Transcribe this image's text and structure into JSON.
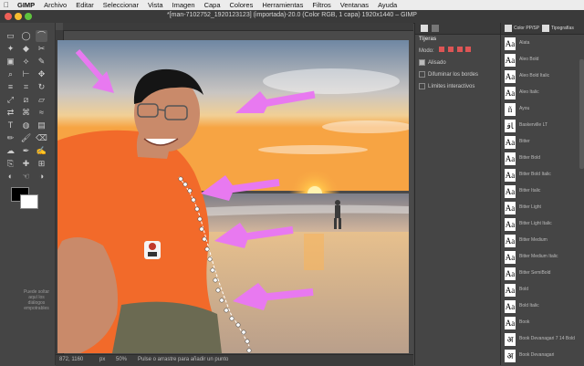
{
  "menubar": {
    "app": "GIMP",
    "items": [
      "Archivo",
      "Editar",
      "Seleccionar",
      "Vista",
      "Imagen",
      "Capa",
      "Colores",
      "Herramientas",
      "Filtros",
      "Ventanas",
      "Ayuda"
    ]
  },
  "window": {
    "title": "*[man-7102752_1920123123] (importada)-20.0 (Color RGB, 1 capa) 1920x1440 – GIMP"
  },
  "toolbox": {
    "hint": "Puede soltar aquí los diálogos empotrables",
    "icons": [
      "rect-select-icon",
      "ellipse-select-icon",
      "free-select-icon",
      "fuzzy-select-icon",
      "color-select-icon",
      "scissors-select-icon",
      "foreground-select-icon",
      "paths-icon",
      "color-picker-icon",
      "zoom-icon",
      "measure-icon",
      "move-icon",
      "align-icon",
      "crop-icon",
      "rotate-icon",
      "scale-icon",
      "shear-icon",
      "perspective-icon",
      "flip-icon",
      "cage-icon",
      "warp-icon",
      "text-icon",
      "bucket-fill-icon",
      "gradient-icon",
      "pencil-icon",
      "paintbrush-icon",
      "eraser-icon",
      "airbrush-icon",
      "ink-icon",
      "mypaint-icon",
      "clone-icon",
      "heal-icon",
      "perspective-clone-icon",
      "blur-icon",
      "smudge-icon",
      "dodge-icon"
    ],
    "active_index": 2
  },
  "tool_options": {
    "panel_title": "Tijeras",
    "mode_label": "Modo:",
    "options": [
      {
        "label": "Alisado",
        "checked": true
      },
      {
        "label": "Difuminar los bordes",
        "checked": false
      },
      {
        "label": "Límites interactivos",
        "checked": false
      }
    ]
  },
  "fonts_panel": {
    "tabs": [
      "Color PP/SP",
      "Tipografías"
    ],
    "fonts": [
      {
        "sample": "Aa",
        "name": "Alata"
      },
      {
        "sample": "Aa",
        "name": "Aleo Bold"
      },
      {
        "sample": "Aa",
        "name": "Aleo Bold Italic"
      },
      {
        "sample": "Aa",
        "name": "Aleo Italic"
      },
      {
        "sample": "ñ",
        "name": "Ayou"
      },
      {
        "sample": "ﺎﻗ",
        "name": "Baskerville LT"
      },
      {
        "sample": "Aa",
        "name": "Bitter"
      },
      {
        "sample": "Aa",
        "name": "Bitter Bold"
      },
      {
        "sample": "Aa",
        "name": "Bitter Bold Italic"
      },
      {
        "sample": "Aa",
        "name": "Bitter Italic"
      },
      {
        "sample": "Aa",
        "name": "Bitter Light"
      },
      {
        "sample": "Aa",
        "name": "Bitter Light Italic"
      },
      {
        "sample": "Aa",
        "name": "Bitter Medium"
      },
      {
        "sample": "Aa",
        "name": "Bitter Medium Italic"
      },
      {
        "sample": "Aa",
        "name": "Bitter SemiBold"
      },
      {
        "sample": "Aa",
        "name": "Bold"
      },
      {
        "sample": "Aa",
        "name": "Bold Italic"
      },
      {
        "sample": "Aa",
        "name": "Book"
      },
      {
        "sample": "अ",
        "name": "Book Devanagari 7 14 Bold"
      },
      {
        "sample": "अ",
        "name": "Book Devanagari"
      }
    ]
  },
  "statusbar": {
    "coords": "872, 1160",
    "unit": "px",
    "zoom": "50%",
    "message": "Pulse o arrastre para añadir un punto"
  },
  "colors": {
    "sky_top": "#6f87a3",
    "sunset": "#f7a443",
    "shirt": "#f26a2a",
    "arrow": "#e879f0",
    "panel": "#454545"
  }
}
